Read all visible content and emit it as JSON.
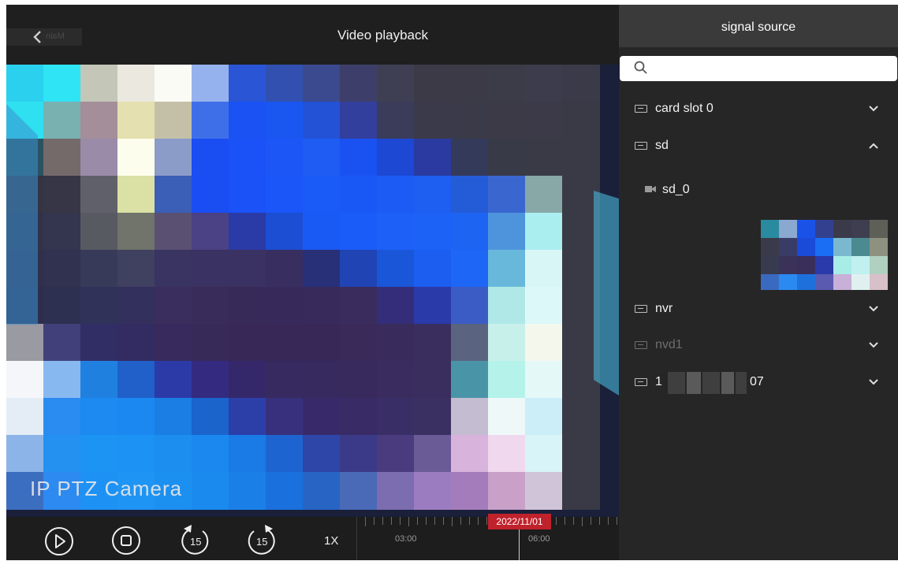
{
  "header": {
    "back_label": "Main",
    "title": "Video playback"
  },
  "video": {
    "overlay_text": "IP PTZ Camera"
  },
  "controls": {
    "play_icon": "play-icon",
    "stop_icon": "stop-icon",
    "rewind_label": "15",
    "forward_label": "15",
    "speed": "1X"
  },
  "timeline": {
    "date": "2022/11/01",
    "labels": [
      "03:00",
      "06:00"
    ]
  },
  "sidebar": {
    "title": "signal source",
    "search": {
      "placeholder": "",
      "value": ""
    },
    "items": [
      {
        "label": "card slot 0",
        "expanded": false
      },
      {
        "label": "sd",
        "expanded": true,
        "children": [
          {
            "label": "sd_0"
          }
        ]
      },
      {
        "label": "nvr",
        "expanded": false
      },
      {
        "label": "nvd1",
        "expanded": false,
        "disabled": true
      },
      {
        "label": "1",
        "label_tail": "07",
        "expanded": false,
        "redacted": true
      }
    ]
  },
  "colors": {
    "accent_red": "#c0222c",
    "panel_bg": "#262626",
    "header_bg": "#3a3a3a"
  }
}
